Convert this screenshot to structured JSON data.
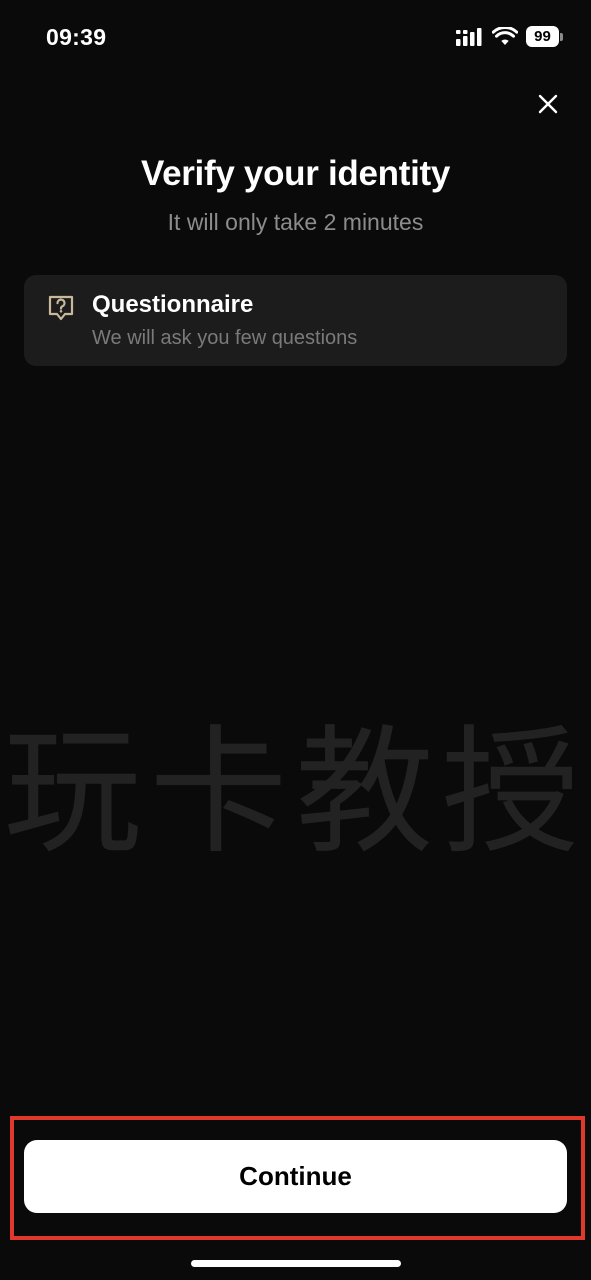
{
  "status_bar": {
    "time": "09:39",
    "battery_level": "99",
    "icons": [
      "signal-icon",
      "wifi-icon",
      "battery-icon"
    ]
  },
  "header": {
    "title": "Verify your identity",
    "subtitle": "It will only take 2 minutes"
  },
  "steps": [
    {
      "icon": "question-bubble-icon",
      "title": "Questionnaire",
      "subtitle": "We will ask you few questions"
    }
  ],
  "watermark": "玩卡教授",
  "actions": {
    "continue_label": "Continue"
  },
  "colors": {
    "background": "#0a0a0a",
    "card": "#1c1c1c",
    "icon_accent": "#c8b99a",
    "highlight": "#e0392b",
    "button": "#ffffff"
  }
}
